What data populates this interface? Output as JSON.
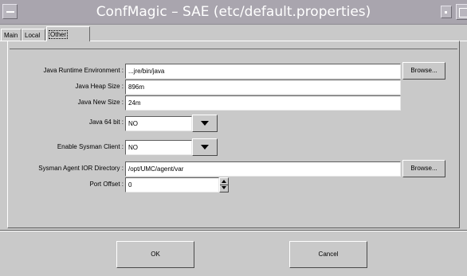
{
  "window": {
    "title": "ConfMagic – SAE (etc/default.properties)"
  },
  "tabs": [
    {
      "label": "Main"
    },
    {
      "label": "Local"
    },
    {
      "label": "Other"
    }
  ],
  "form": {
    "jre_label": "Java Runtime Environment :",
    "jre_value": "...jre/bin/java",
    "heap_label": "Java Heap Size :",
    "heap_value": "896m",
    "new_label": "Java New Size :",
    "new_value": "24m",
    "bit64_label": "Java 64 bit :",
    "bit64_value": "NO",
    "sysman_label": "Enable Sysman Client :",
    "sysman_value": "NO",
    "ior_label": "Sysman Agent IOR Directory :",
    "ior_value": "/opt/UMC/agent/var",
    "port_label": "Port Offset :",
    "port_value": "0",
    "browse_label": "Browse..."
  },
  "footer": {
    "ok_label": "OK",
    "cancel_label": "Cancel"
  },
  "colors": {
    "titlebar": "#a9a5ae",
    "background": "#c9c9c9",
    "field": "#ffffff"
  }
}
